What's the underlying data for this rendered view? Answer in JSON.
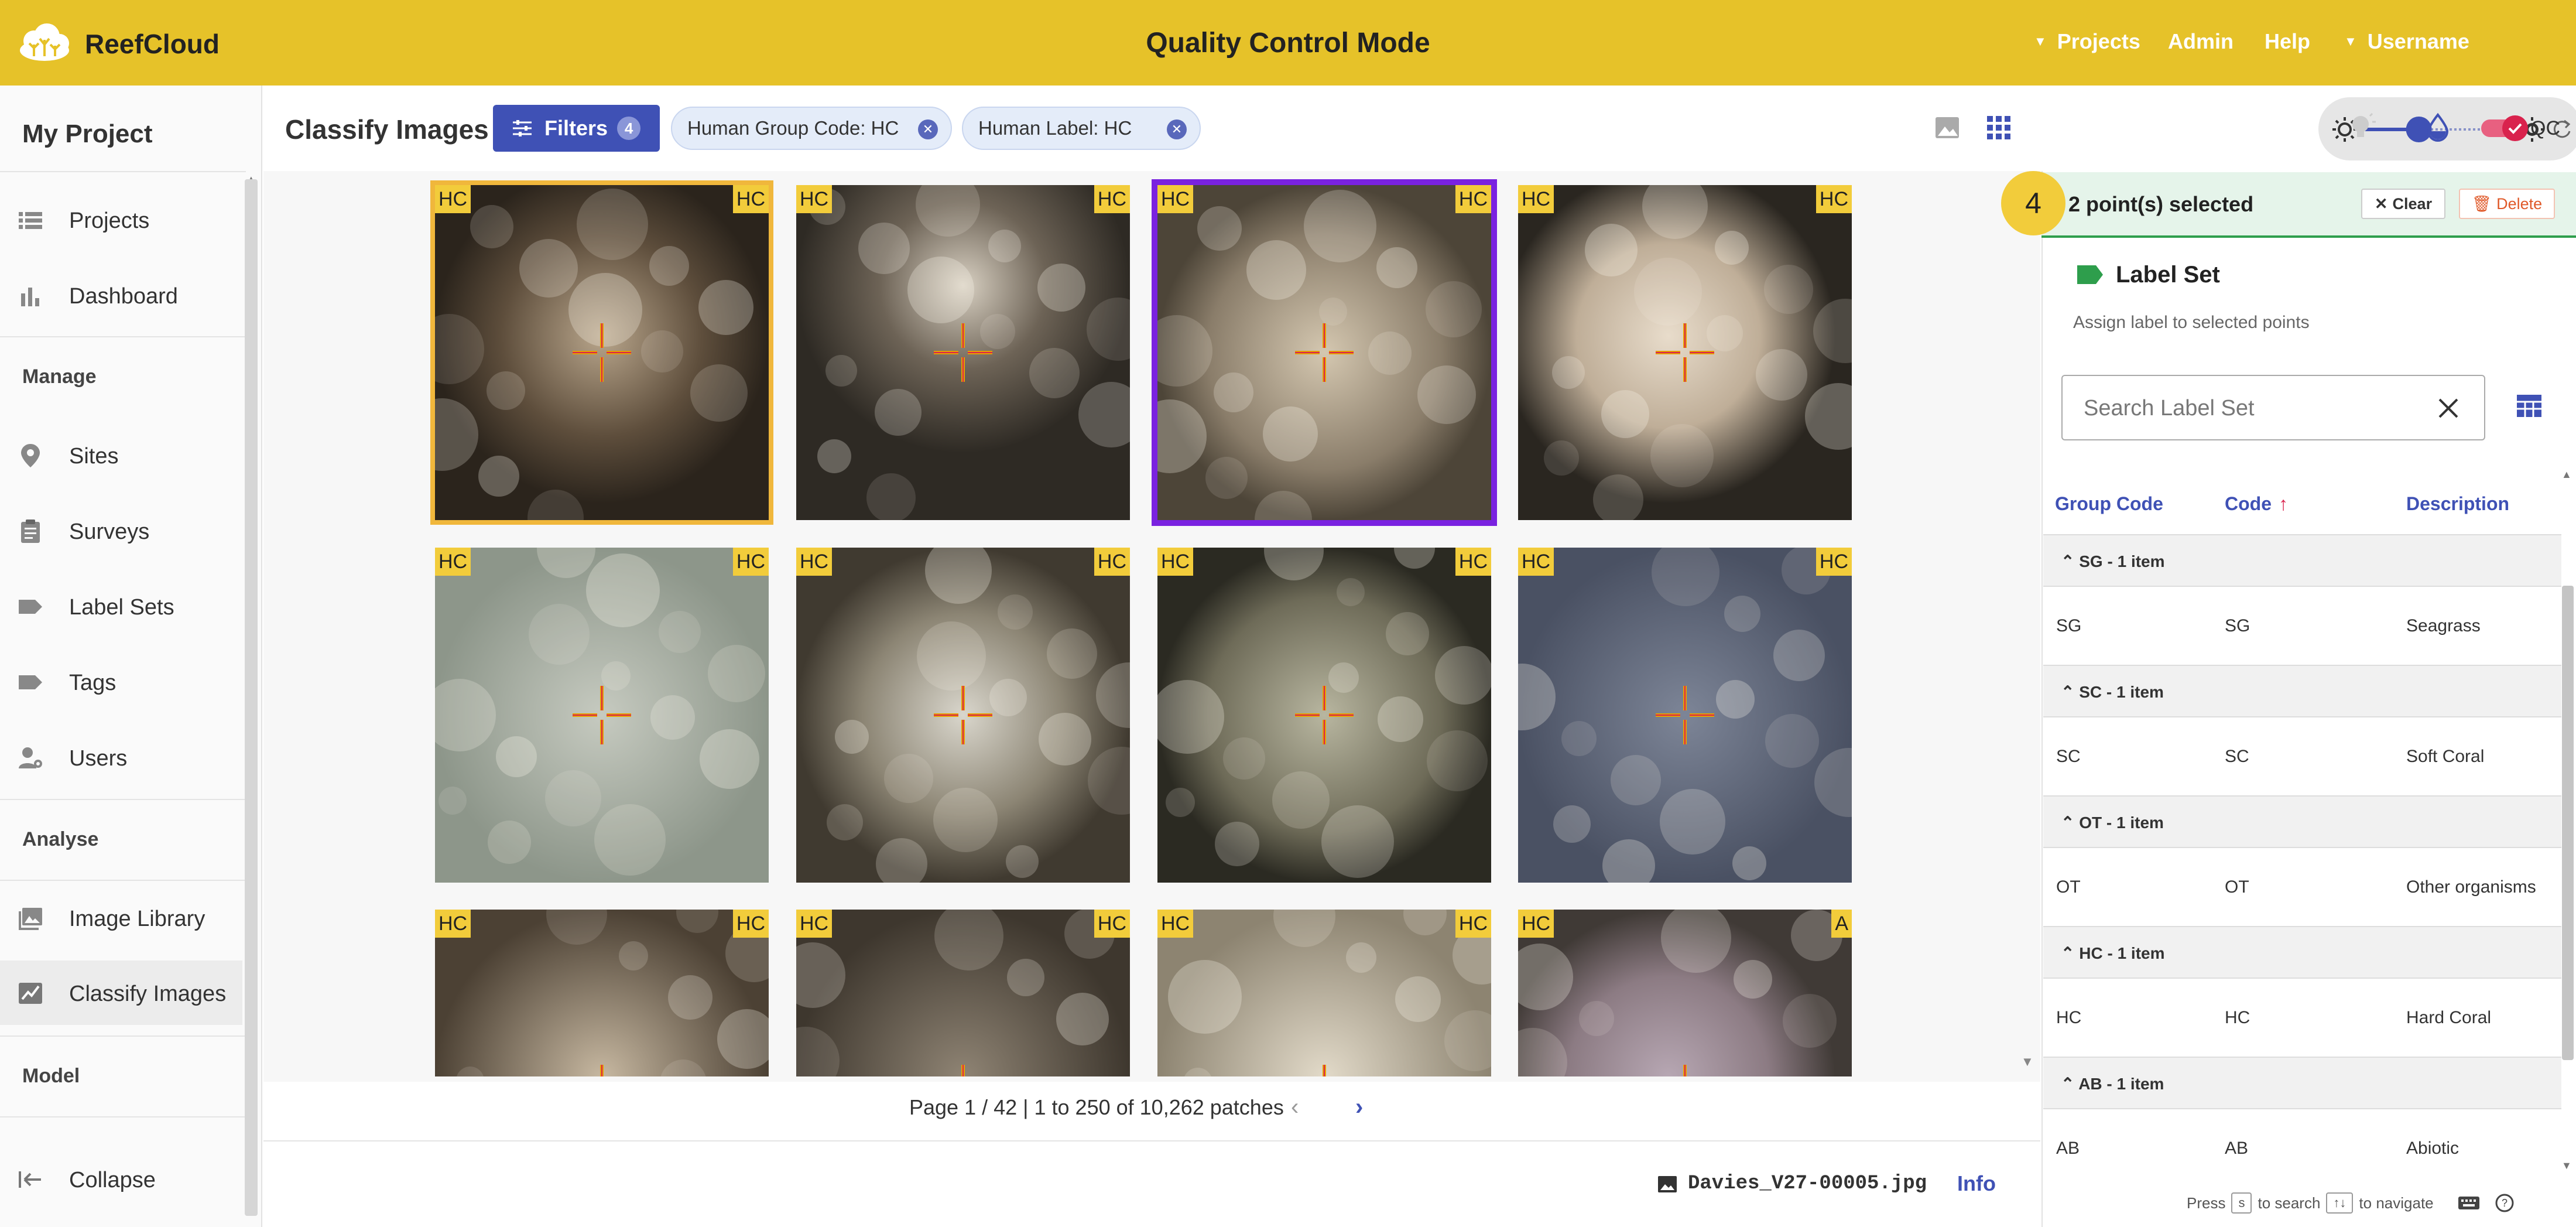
{
  "app": {
    "brand": "ReefCloud",
    "mode_title": "Quality Control Mode"
  },
  "topnav": {
    "projects": "Projects",
    "admin": "Admin",
    "help": "Help",
    "username": "Username"
  },
  "sidebar": {
    "project_title": "My Project",
    "items": [
      {
        "label": "Projects",
        "icon": "list-icon"
      },
      {
        "label": "Dashboard",
        "icon": "bar-chart-icon"
      },
      {
        "label": "Sites",
        "icon": "location-pin-icon"
      },
      {
        "label": "Surveys",
        "icon": "clipboard-icon"
      },
      {
        "label": "Label Sets",
        "icon": "label-tag-icon"
      },
      {
        "label": "Tags",
        "icon": "tag-icon"
      },
      {
        "label": "Users",
        "icon": "users-settings-icon"
      },
      {
        "label": "Image Library",
        "icon": "image-library-icon"
      },
      {
        "label": "Classify Images",
        "icon": "classify-icon"
      }
    ],
    "sections": {
      "manage": "Manage",
      "analyse": "Analyse",
      "model": "Model"
    },
    "collapse": "Collapse"
  },
  "toolbar": {
    "title": "Classify Images",
    "filters_label": "Filters",
    "filters_count": "4",
    "chips": [
      "Human Group Code: HC",
      "Human Label: HC"
    ],
    "qc_label": "QC",
    "brightness_level": 0.12
  },
  "grid": {
    "tiles": [
      {
        "left": "HC",
        "right": "HC"
      },
      {
        "left": "HC",
        "right": "HC"
      },
      {
        "left": "HC",
        "right": "HC"
      },
      {
        "left": "HC",
        "right": "HC"
      },
      {
        "left": "HC",
        "right": "HC"
      },
      {
        "left": "HC",
        "right": "HC"
      },
      {
        "left": "HC",
        "right": "HC"
      },
      {
        "left": "HC",
        "right": "HC"
      },
      {
        "left": "HC",
        "right": "HC"
      },
      {
        "left": "HC",
        "right": "HC"
      },
      {
        "left": "HC",
        "right": "HC"
      },
      {
        "left": "HC",
        "right": "A"
      }
    ],
    "pagination": "Page 1 / 42 | 1 to 250 of 10,262 patches"
  },
  "footer": {
    "filename": "Davies_V27-00005.jpg",
    "info": "Info"
  },
  "panel": {
    "selected_count": "4",
    "selected_text": "2 point(s) selected",
    "clear": "Clear",
    "delete": "Delete",
    "label_set_title": "Label Set",
    "label_set_sub": "Assign label to selected points",
    "search_placeholder": "Search Label Set",
    "columns": {
      "group": "Group Code",
      "code": "Code",
      "description": "Description"
    },
    "groups": [
      {
        "header": "SG - 1 item",
        "group": "SG",
        "code": "SG",
        "description": "Seagrass"
      },
      {
        "header": "SC - 1 item",
        "group": "SC",
        "code": "SC",
        "description": "Soft Coral"
      },
      {
        "header": "OT - 1 item",
        "group": "OT",
        "code": "OT",
        "description": "Other organisms"
      },
      {
        "header": "HC - 1 item",
        "group": "HC",
        "code": "HC",
        "description": "Hard Coral"
      },
      {
        "header": "AB - 1 item",
        "group": "AB",
        "code": "AB",
        "description": "Abiotic"
      }
    ],
    "hint": {
      "press": "Press",
      "key_search": "s",
      "to_search": "to search",
      "key_nav": "↑↓",
      "to_navigate": "to navigate"
    }
  },
  "colors": {
    "topbar": "#e6c229",
    "accent": "#3f51b5",
    "selection_purple": "#7a22e0",
    "selection_orange": "#f0b73c",
    "tag": "#f2cc3b",
    "success": "#2e9e4c"
  }
}
